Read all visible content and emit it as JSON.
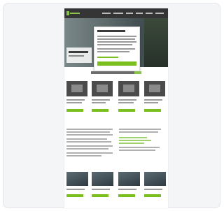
{
  "screenshot": {
    "description_hidden": ""
  },
  "colors": {
    "accent": "#7bbf1f",
    "header": "#353535",
    "tile": "#4b4b4b",
    "card": "#f4f5f7"
  },
  "icons": [
    "brand-logo-icon"
  ]
}
